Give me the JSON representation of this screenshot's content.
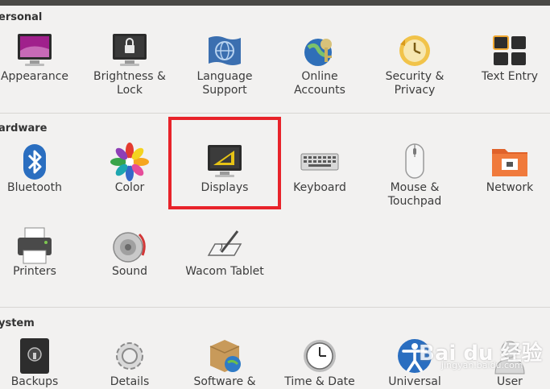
{
  "sections": {
    "personal": "ersonal",
    "hardware": "ardware",
    "system": "ystem"
  },
  "personal_items": [
    "Appearance",
    "Brightness &\nLock",
    "Language\nSupport",
    "Online\nAccounts",
    "Security &\nPrivacy",
    "Text Entry"
  ],
  "items": {
    "appearance": "Appearance",
    "brightness_1": "Brightness &",
    "brightness_2": "Lock",
    "language_1": "Language",
    "language_2": "Support",
    "online_1": "Online",
    "online_2": "Accounts",
    "security_1": "Security &",
    "security_2": "Privacy",
    "text_entry": "Text Entry",
    "bluetooth": "Bluetooth",
    "color": "Color",
    "displays": "Displays",
    "keyboard": "Keyboard",
    "mouse_1": "Mouse &",
    "mouse_2": "Touchpad",
    "network": "Network",
    "printers": "Printers",
    "sound": "Sound",
    "wacom": "Wacom Tablet",
    "backups": "Backups",
    "details": "Details",
    "software": "Software &",
    "time_date": "Time & Date",
    "universal": "Universal",
    "user": "User"
  },
  "watermark": {
    "logo": "Bai du 经验",
    "url": "jingyan.baidu.com"
  },
  "colors": {
    "highlight": "#e8232a",
    "background": "#f2f1f0"
  }
}
